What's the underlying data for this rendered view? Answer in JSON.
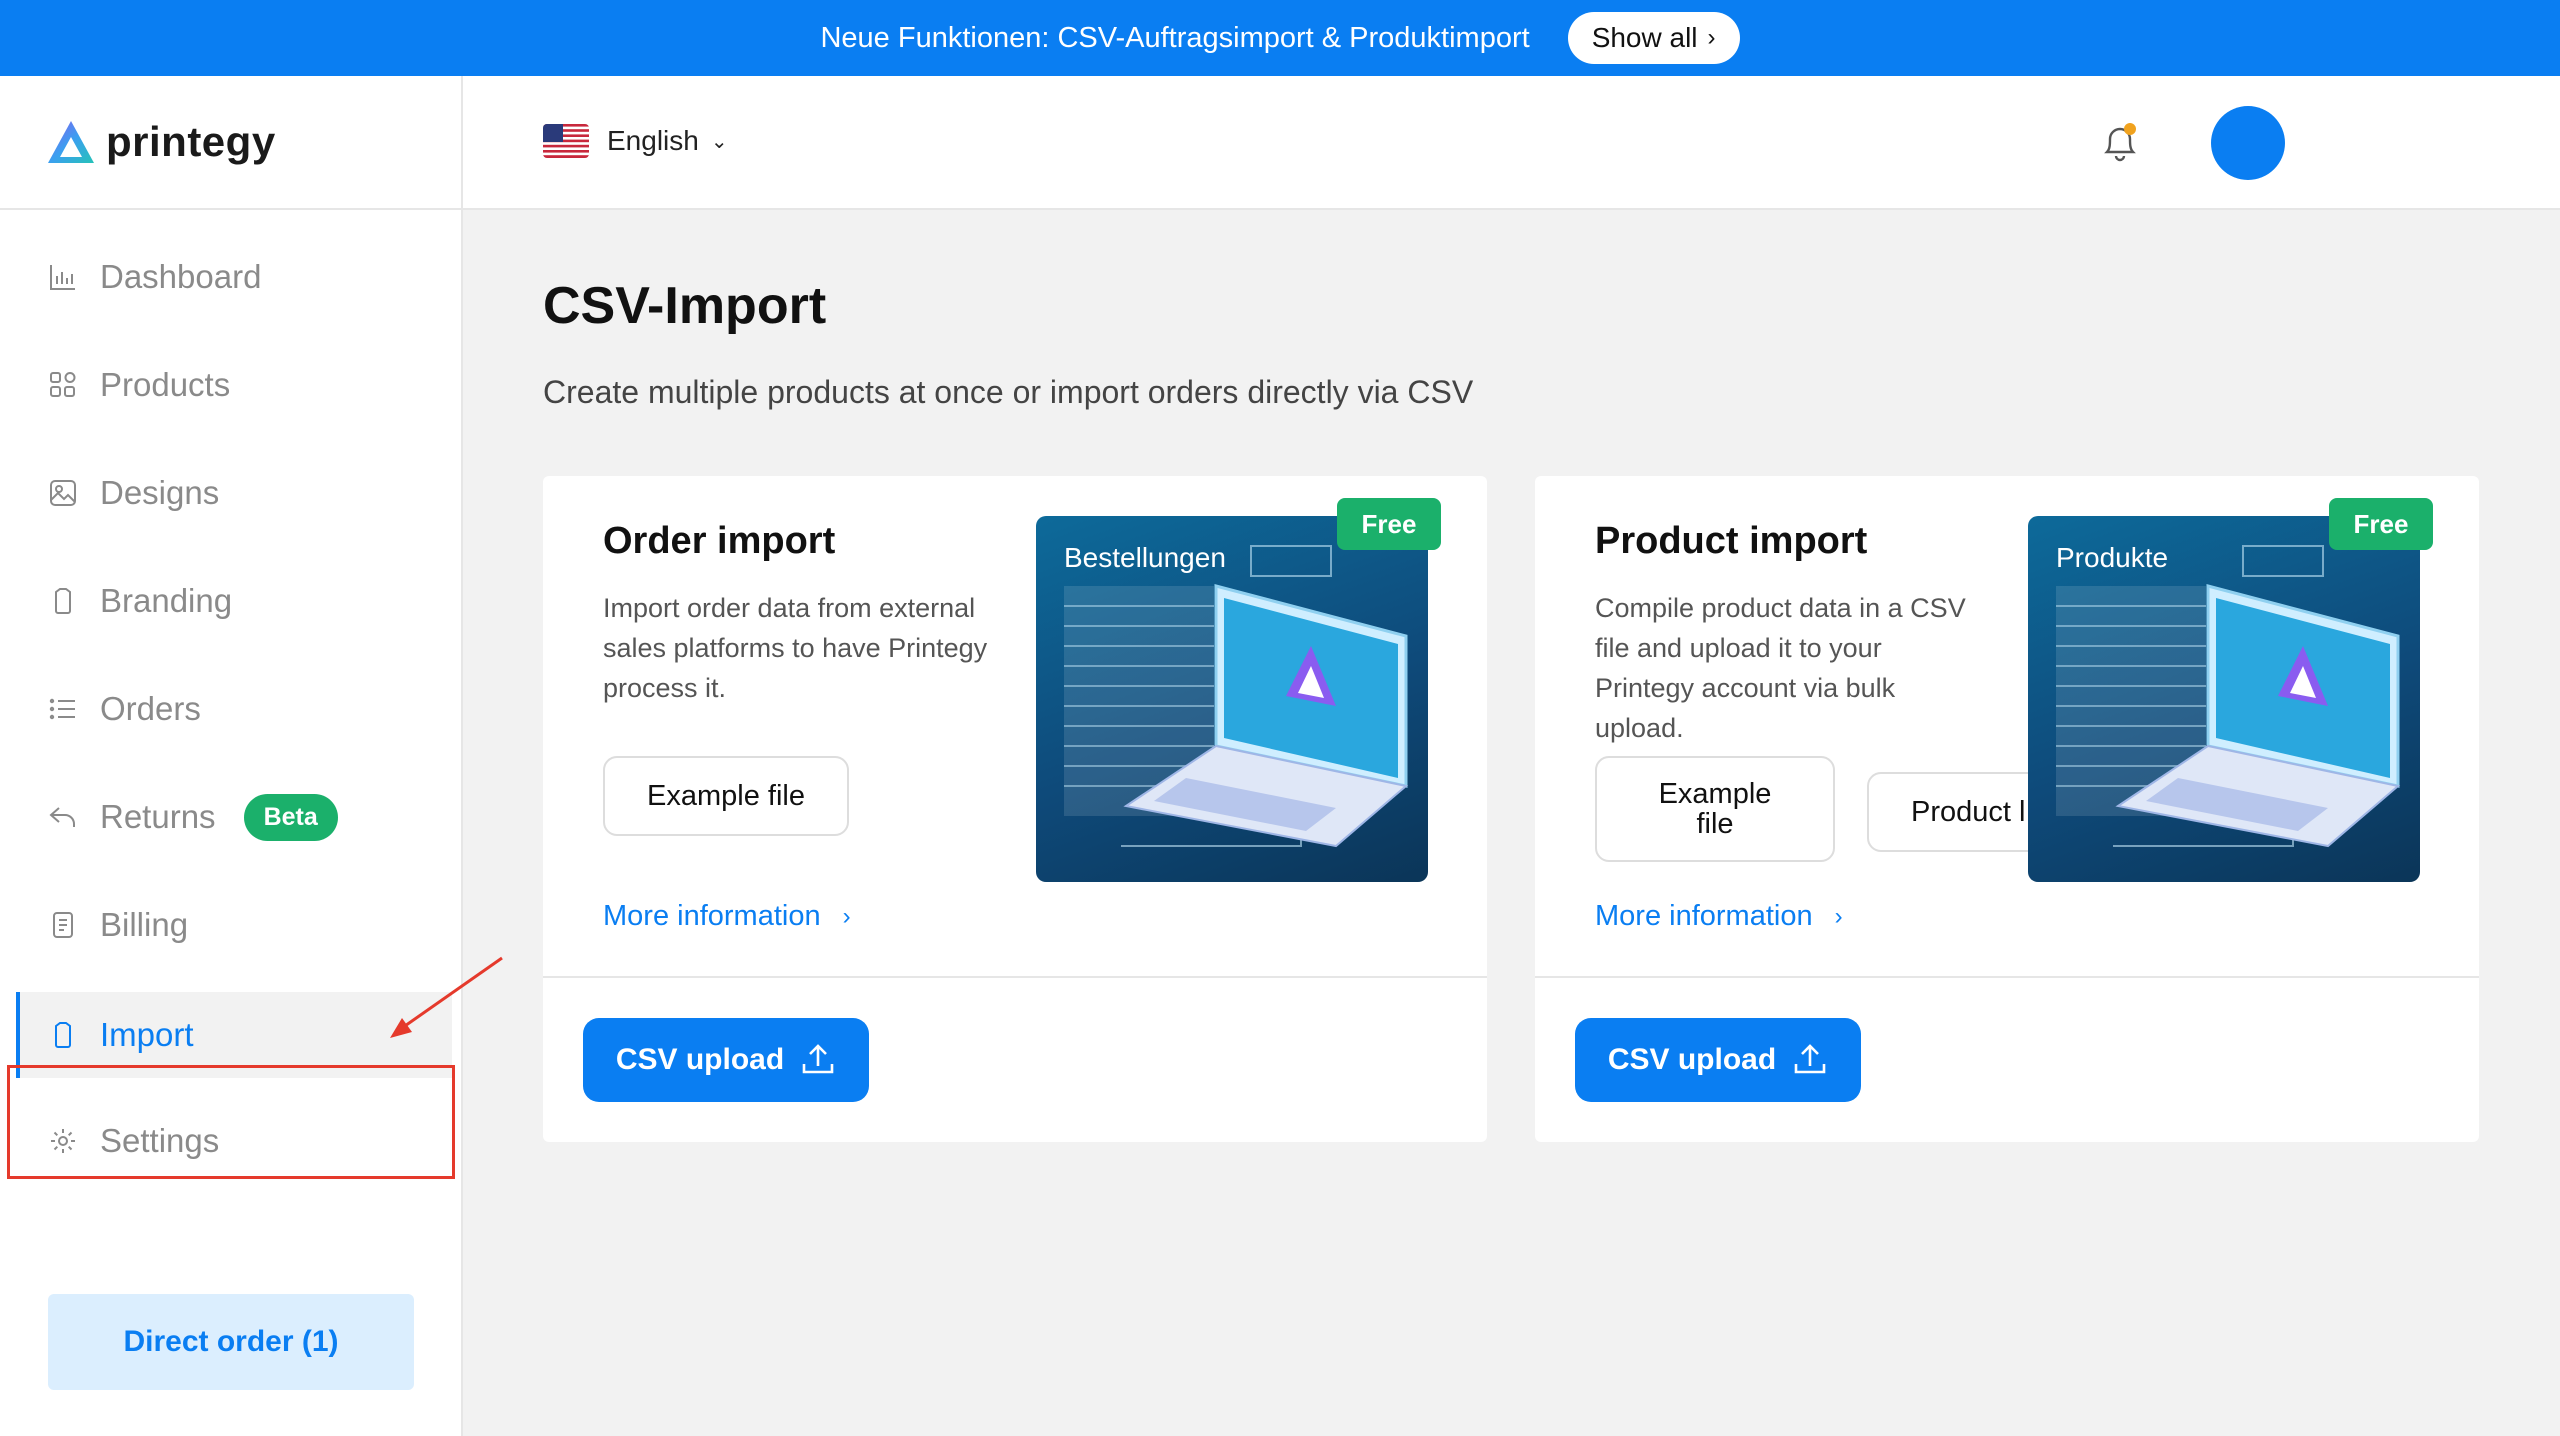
{
  "banner": {
    "text": "Neue Funktionen: CSV-Auftragsimport & Produktimport",
    "button_label": "Show all",
    "button_icon": "chevron-right-icon"
  },
  "brand": {
    "name": "printegy",
    "color": "#0a7ef2"
  },
  "header": {
    "language": "English",
    "flag_icon": "us-flag-icon",
    "bell_icon": "notification-bell-icon",
    "notification_dot_color": "#f0a21e"
  },
  "sidebar": {
    "items": [
      {
        "label": "Dashboard",
        "icon": "bar-chart-icon"
      },
      {
        "label": "Products",
        "icon": "grid-icon"
      },
      {
        "label": "Designs",
        "icon": "image-icon"
      },
      {
        "label": "Branding",
        "icon": "tag-icon"
      },
      {
        "label": "Orders",
        "icon": "list-icon"
      },
      {
        "label": "Returns",
        "icon": "return-arrow-icon",
        "badge": "Beta"
      },
      {
        "label": "Billing",
        "icon": "receipt-icon"
      },
      {
        "label": "Import",
        "icon": "tag-icon",
        "active": true
      },
      {
        "label": "Settings",
        "icon": "gear-icon"
      }
    ],
    "direct_order": "Direct order (1)"
  },
  "main": {
    "title": "CSV-Import",
    "subtitle": "Create multiple products at once or import orders directly via CSV",
    "cards": [
      {
        "title": "Order import",
        "description": "Import order data from external sales platforms to have Printegy process it.",
        "buttons": [
          "Example file"
        ],
        "more_link": "More information",
        "upload_label": "CSV upload",
        "thumb_label": "Bestellungen",
        "badge": "Free"
      },
      {
        "title": "Product import",
        "description": "Compile product data in a CSV file and upload it to your Printegy account via bulk upload.",
        "buttons": [
          "Example file",
          "Product l"
        ],
        "more_link": "More information",
        "upload_label": "CSV upload",
        "thumb_label": "Produkte",
        "badge": "Free"
      }
    ]
  },
  "colors": {
    "accent": "#0a7ef2",
    "badge_green": "#1bb06b",
    "highlight_red": "#e53a2c"
  }
}
